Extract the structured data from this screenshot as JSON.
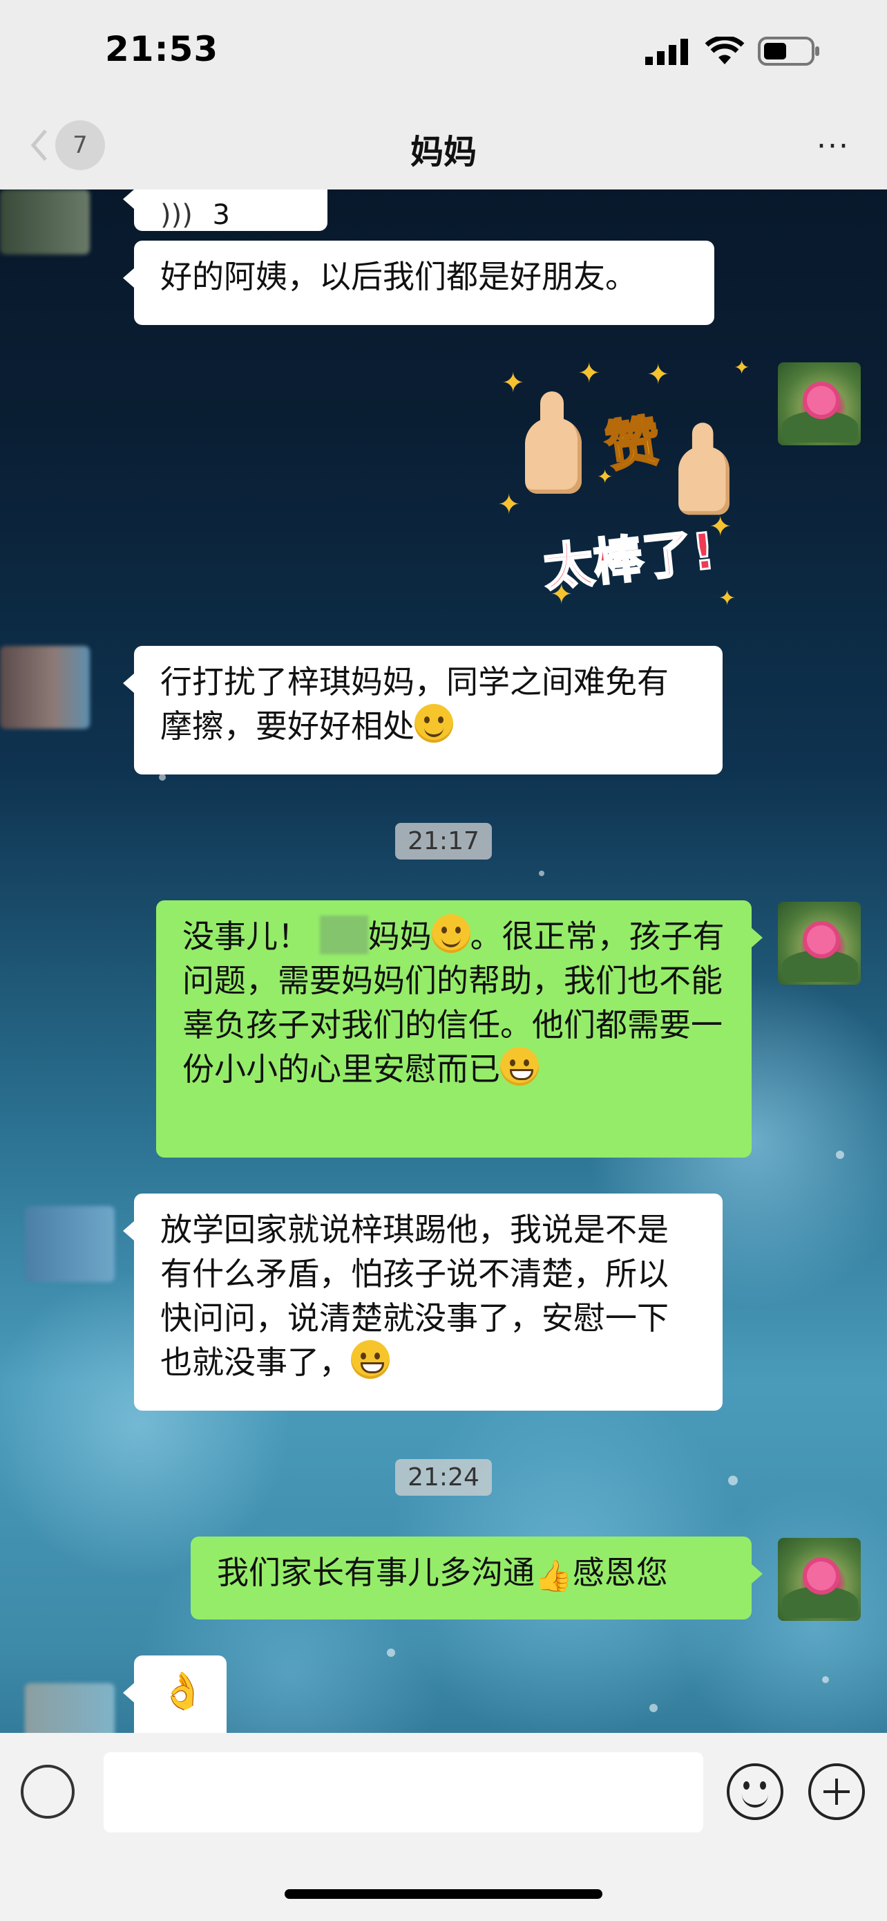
{
  "status_bar": {
    "time": "21:53"
  },
  "nav": {
    "back_badge": "7",
    "title": "妈妈",
    "more": "···"
  },
  "messages": [
    {
      "id": "m0",
      "side": "left",
      "text": "3"
    },
    {
      "id": "m1",
      "side": "left",
      "text": "好的阿姨，以后我们都是好朋友。"
    },
    {
      "id": "m2",
      "side": "right",
      "sticker": {
        "line1": "赞",
        "line2": "太棒了!"
      }
    },
    {
      "id": "m3",
      "side": "left",
      "text": "行打扰了梓琪妈妈，同学之间难免有摩擦，要好好相处"
    },
    {
      "id": "t1",
      "timestamp": "21:17"
    },
    {
      "id": "m4",
      "side": "right",
      "text_a": "没事儿！",
      "text_b": "妈妈",
      "text_c": "。很正常，孩子有问题，需要妈妈们的帮助，我们也不能辜负孩子对我们的信任。他们都需要一份小小的心里安慰而已"
    },
    {
      "id": "m5",
      "side": "left",
      "text": "放学回家就说梓琪踢他，我说是不是有什么矛盾，怕孩子说不清楚，所以快问问，说清楚就没事了，安慰一下也就没事了，"
    },
    {
      "id": "t2",
      "timestamp": "21:24"
    },
    {
      "id": "m6",
      "side": "right",
      "text_a": "我们家长有事儿多沟通",
      "text_b": "感恩您"
    },
    {
      "id": "m7",
      "side": "left",
      "emoji": "ok-hand"
    }
  ],
  "icons": {
    "signal": "signal-icon",
    "wifi": "wifi-icon",
    "battery": "battery-icon",
    "back": "chevron-left-icon",
    "more": "more-icon",
    "voice": "voice-icon",
    "emoji": "emoji-icon",
    "plus": "plus-icon"
  },
  "colors": {
    "bubble_self": "#95ec69",
    "bubble_other": "#ffffff",
    "bar_bg": "#ededed"
  }
}
